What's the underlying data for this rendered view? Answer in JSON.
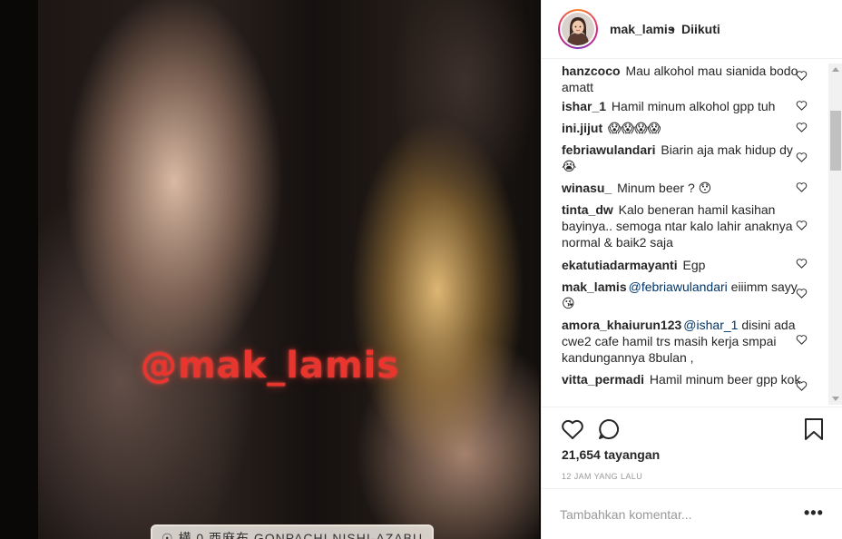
{
  "media": {
    "watermark": "@mak_lamis",
    "location_tag": "☉ 横 0 西麻布 GONPACHI NISHI-AZABU"
  },
  "header": {
    "username": "mak_lamis",
    "separator": "•",
    "follow_status": "Diikuti"
  },
  "comments": [
    {
      "user": "hanzcoco",
      "text": " Mau alkohol mau sianida bodo amatt"
    },
    {
      "user": "ishar_1",
      "text": " Hamil minum alkohol gpp tuh"
    },
    {
      "user": "ini.jijut",
      "text": " 😱😱😱😱"
    },
    {
      "user": "febriawulandari",
      "text": " Biarin aja mak hidup dy😭"
    },
    {
      "user": "winasu_",
      "text": " Minum beer ? 😯"
    },
    {
      "user": "tinta_dw",
      "text": " Kalo beneran hamil kasihan bayinya.. semoga ntar kalo lahir anaknya normal & baik2 saja"
    },
    {
      "user": "ekatutiadarmayanti",
      "text": " Egp"
    },
    {
      "user": "mak_lamis",
      "mention": "@febriawulandari",
      "text": " eiiimm sayy😘"
    },
    {
      "user": "amora_khaiurun123",
      "mention": "@ishar_1",
      "text": " disini ada cwe2 cafe hamil trs masih kerja smpai kandungannya 8bulan ,"
    },
    {
      "user": "vitta_permadi",
      "text": " Hamil minum beer gpp kok"
    }
  ],
  "stats": {
    "views": "21,654 tayangan",
    "time": "12 JAM YANG LALU"
  },
  "add_comment": {
    "placeholder": "Tambahkan komentar...",
    "more": "•••"
  },
  "icons": {
    "like": "heart-icon",
    "comment": "comment-icon",
    "save": "bookmark-icon",
    "comment_like": "heart-outline-icon",
    "more": "more-options-icon"
  },
  "colors": {
    "watermark": "#e8352e",
    "mention": "#003569",
    "muted": "#999999",
    "text": "#262626"
  }
}
